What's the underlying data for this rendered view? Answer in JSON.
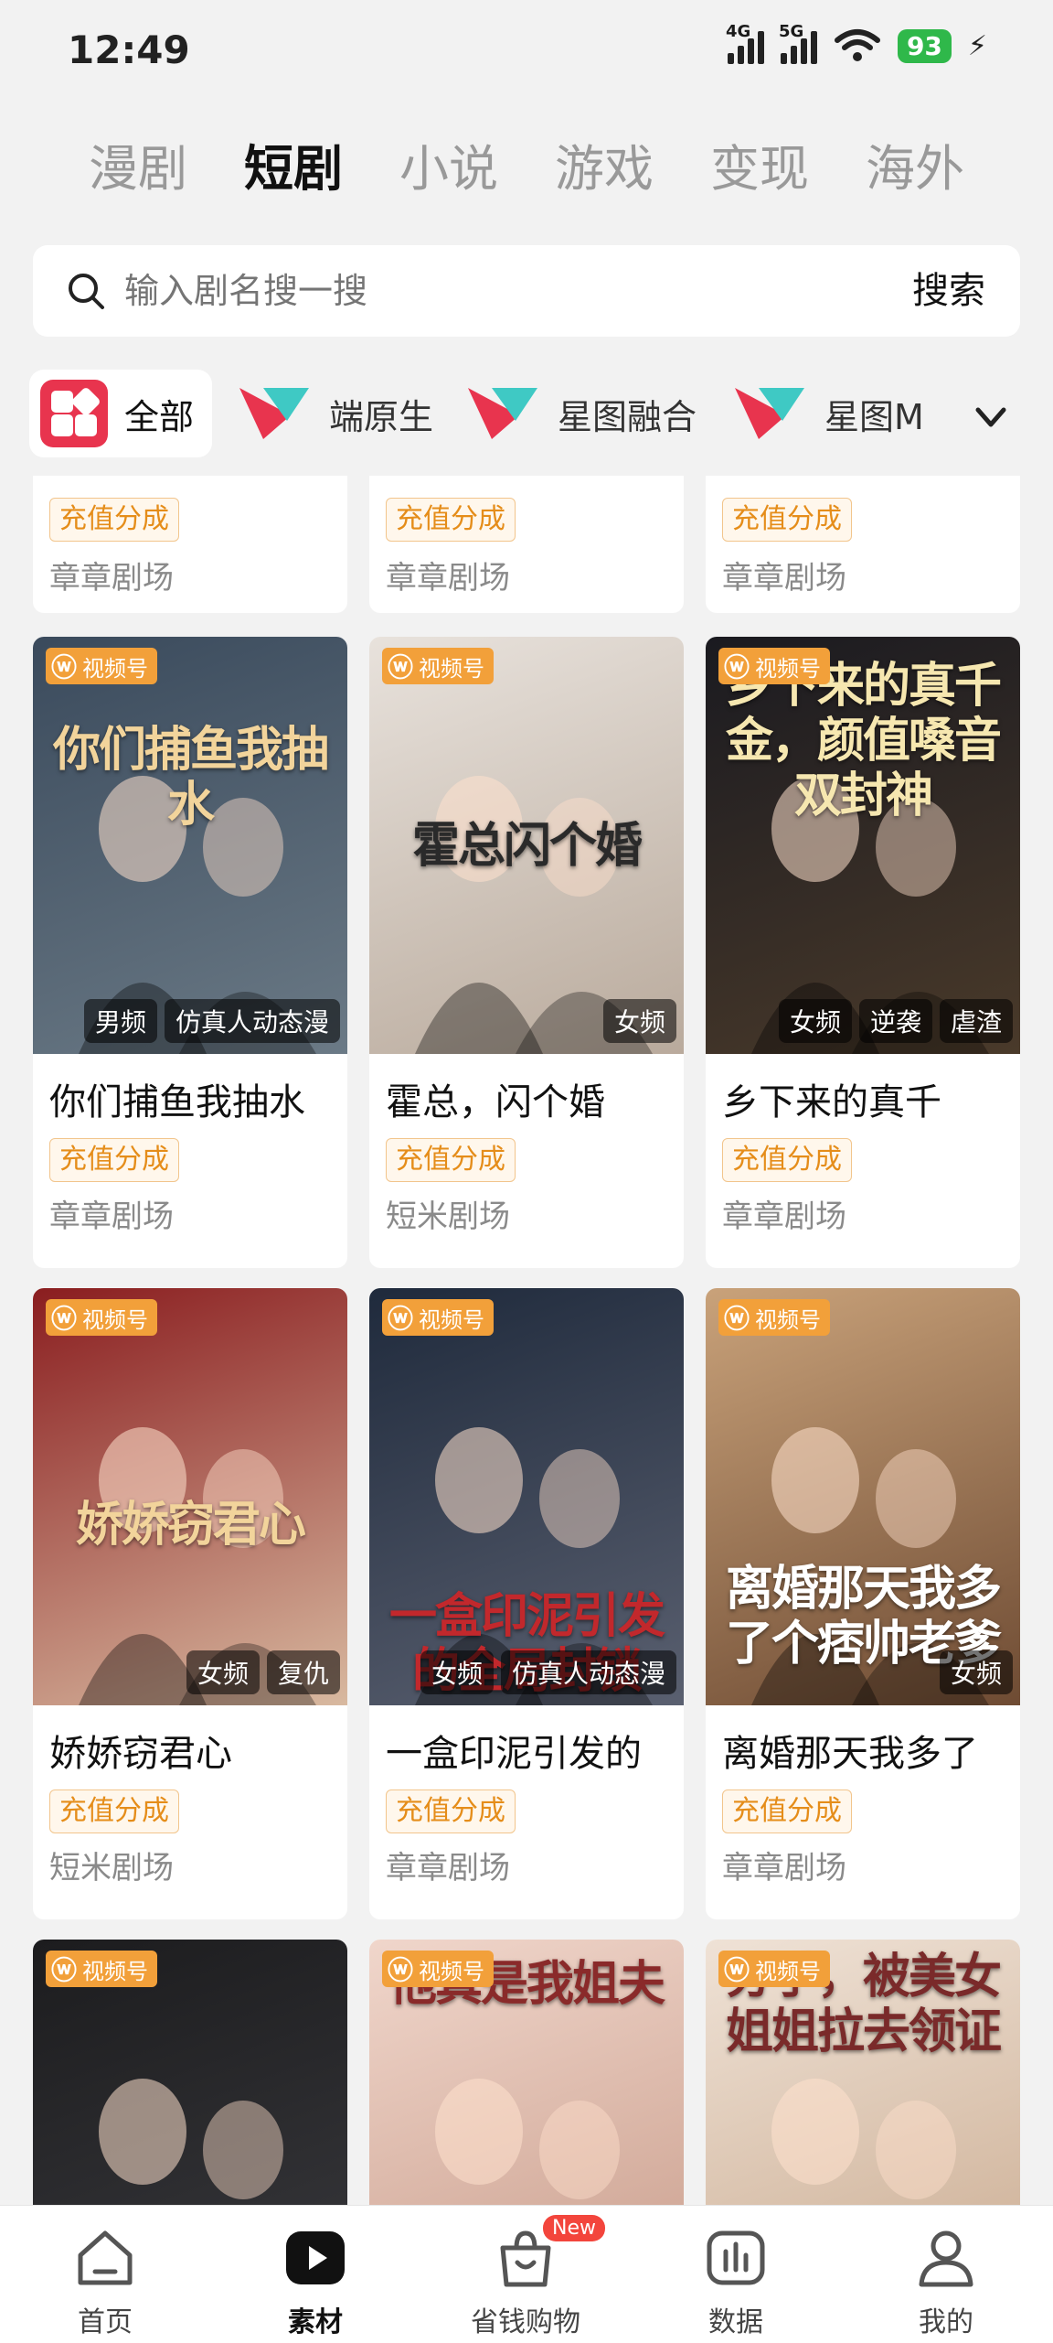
{
  "status_bar": {
    "time": "12:49",
    "net1": "4G",
    "net2": "5G",
    "battery": "93",
    "battery_icon": "battery-charging-icon"
  },
  "category_tabs": [
    {
      "label": "漫剧"
    },
    {
      "label": "短剧",
      "active": true
    },
    {
      "label": "小说"
    },
    {
      "label": "游戏"
    },
    {
      "label": "变现"
    },
    {
      "label": "海外"
    }
  ],
  "search": {
    "placeholder": "输入剧名搜一搜",
    "button_label": "搜索"
  },
  "filters": [
    {
      "label": "全部",
      "icon": "grid-icon"
    },
    {
      "label": "端原生",
      "icon": "brand-icon"
    },
    {
      "label": "星图融合",
      "icon": "brand-icon"
    },
    {
      "label": "星图M",
      "icon": "brand-icon"
    }
  ],
  "platform_badge": "视频号",
  "partial_row": [
    {
      "badge": "充值分成",
      "studio": "章章剧场"
    },
    {
      "badge": "充值分成",
      "studio": "章章剧场"
    },
    {
      "badge": "充值分成",
      "studio": "章章剧场"
    }
  ],
  "cards": [
    {
      "title": "你们捕鱼我抽水",
      "poster_text": "你们捕鱼我抽水",
      "tags": [
        "男频",
        "仿真人动态漫"
      ],
      "badge": "充值分成",
      "studio": "章章剧场",
      "colors": [
        "#3a4a5c",
        "#6b7a86"
      ]
    },
    {
      "title": "霍总，闪个婚",
      "poster_text": "霍总闪个婚",
      "tags": [
        "女频"
      ],
      "badge": "充值分成",
      "studio": "短米剧场",
      "colors": [
        "#e8e2dc",
        "#b9aa9c"
      ]
    },
    {
      "title": "乡下来的真千",
      "poster_text": "乡下来的真千金，颜值嗓音双封神",
      "tags": [
        "女频",
        "逆袭",
        "虐渣"
      ],
      "badge": "充值分成",
      "studio": "章章剧场",
      "colors": [
        "#1a1a20",
        "#4a3a2a"
      ]
    },
    {
      "title": "娇娇窃君心",
      "poster_text": "娇娇窃君心",
      "tags": [
        "女频",
        "复仇"
      ],
      "badge": "充值分成",
      "studio": "短米剧场",
      "colors": [
        "#8a1d1f",
        "#d8b9a0"
      ]
    },
    {
      "title": "一盒印泥引发的",
      "poster_text": "一盒印泥引发的全局封锁",
      "tags": [
        "女频",
        "仿真人动态漫"
      ],
      "badge": "充值分成",
      "studio": "章章剧场",
      "colors": [
        "#1f2a3c",
        "#5a6070"
      ]
    },
    {
      "title": "离婚那天我多了",
      "poster_text": "离婚那天我多了个痞帅老爹",
      "tags": [
        "女频"
      ],
      "badge": "充值分成",
      "studio": "章章剧场",
      "colors": [
        "#c9a27a",
        "#6e4b33"
      ]
    },
    {
      "title": "",
      "poster_text": "",
      "tags": [],
      "badge": "",
      "studio": "",
      "colors": [
        "#1c1c1e",
        "#3a3a3e"
      ]
    },
    {
      "title": "",
      "poster_text": "他真是我姐夫",
      "tags": [],
      "badge": "",
      "studio": "",
      "colors": [
        "#f0d6cb",
        "#c79a88"
      ]
    },
    {
      "title": "",
      "poster_text": "分手，被美女姐姐拉去领证",
      "tags": [],
      "badge": "",
      "studio": "",
      "colors": [
        "#efe2d6",
        "#c8a88c"
      ]
    }
  ],
  "bottom_nav": [
    {
      "label": "首页",
      "icon": "home-icon"
    },
    {
      "label": "素材",
      "icon": "play-icon",
      "active": true
    },
    {
      "label": "省钱购物",
      "icon": "shopping-bag-icon",
      "badge": "New"
    },
    {
      "label": "数据",
      "icon": "chart-icon"
    },
    {
      "label": "我的",
      "icon": "profile-icon"
    }
  ]
}
